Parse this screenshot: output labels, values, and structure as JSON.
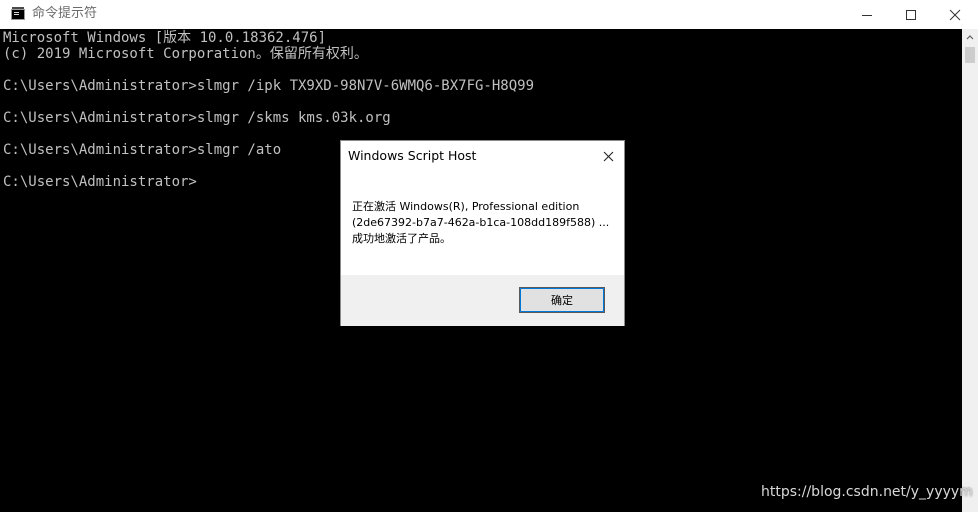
{
  "window": {
    "title": "命令提示符",
    "app_icon": "cmd-console-icon"
  },
  "titlebar_controls": [
    "minimize-icon",
    "maximize-icon",
    "close-icon"
  ],
  "console": {
    "lines": [
      "Microsoft Windows [版本 10.0.18362.476]",
      "(c) 2019 Microsoft Corporation。保留所有权利。",
      "C:\\Users\\Administrator>slmgr /ipk TX9XD-98N7V-6WMQ6-BX7FG-H8Q99",
      "C:\\Users\\Administrator>slmgr /skms kms.03k.org",
      "C:\\Users\\Administrator>slmgr /ato",
      "C:\\Users\\Administrator>"
    ],
    "text_color": "#c0c0c0",
    "background": "#000000"
  },
  "dialog": {
    "title": "Windows Script Host",
    "message_lines": [
      "正在激活 Windows(R), Professional edition",
      "(2de67392-b7a7-462a-b1ca-108dd189f588) ...",
      "成功地激活了产品。"
    ],
    "ok_label": "确定"
  },
  "watermark": "https://blog.csdn.net/y_yyyym"
}
